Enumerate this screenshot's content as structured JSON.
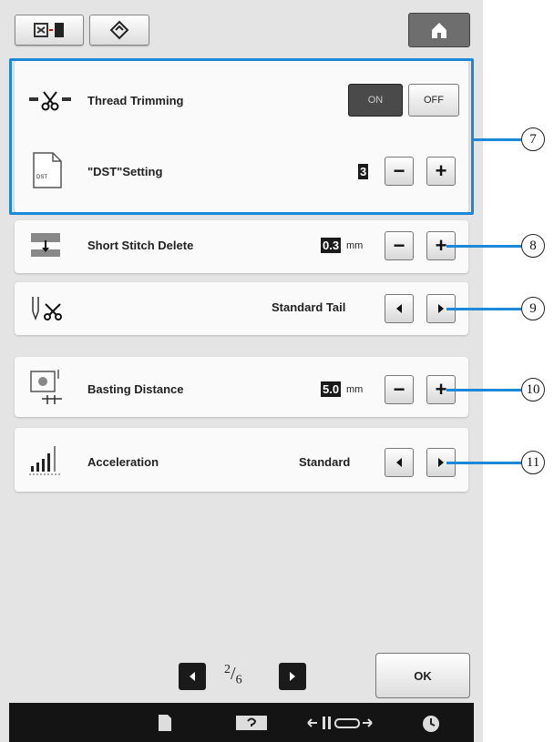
{
  "topbar": {
    "embroidery_icon": "embroidery-frame-icon",
    "settings_icon": "settings-gear-icon",
    "home_icon": "home-icon"
  },
  "rows": {
    "thread_trimming": {
      "label": "Thread Trimming",
      "on_label": "ON",
      "off_label": "OFF",
      "state": "ON"
    },
    "dst_setting": {
      "label": "\"DST\"Setting",
      "value": "3",
      "minus": "−",
      "plus": "+",
      "icon_text": "DST"
    },
    "short_stitch_delete": {
      "label": "Short Stitch Delete",
      "value": "0.3",
      "unit": "mm",
      "minus": "−",
      "plus": "+"
    },
    "tail": {
      "value": "Standard Tail"
    },
    "basting_distance": {
      "label": "Basting Distance",
      "value": "5.0",
      "unit": "mm",
      "minus": "−",
      "plus": "+"
    },
    "acceleration": {
      "label": "Acceleration",
      "value": "Standard"
    }
  },
  "callouts": [
    "7",
    "8",
    "9",
    "10",
    "11"
  ],
  "pagination": {
    "current": "2",
    "total": "6",
    "ok_label": "OK"
  },
  "colors": {
    "highlight": "#1e88d8",
    "panel": "#e4e4e4",
    "bar": "#141414"
  }
}
